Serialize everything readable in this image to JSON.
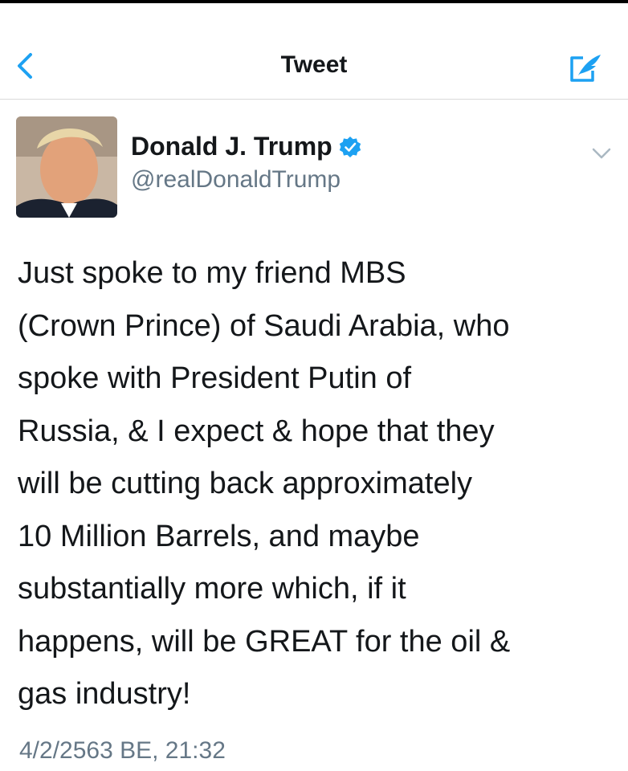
{
  "header": {
    "title": "Tweet",
    "back_icon": "chevron-left-icon",
    "compose_icon": "compose-tweet-icon"
  },
  "tweet": {
    "author": {
      "name": "Donald J. Trump",
      "handle": "@realDonaldTrump",
      "verified": true,
      "avatar_icon": "avatar"
    },
    "text_lines": [
      "Just spoke to my friend MBS",
      "(Crown Prince) of Saudi Arabia, who",
      "spoke with President Putin of",
      "Russia, & I expect & hope that they",
      "will be cutting back approximately",
      "10 Million Barrels, and maybe",
      "substantially more which, if it",
      "happens, will be GREAT for the oil &",
      "gas industry!"
    ],
    "timestamp": "4/2/2563 BE, 21:32"
  },
  "colors": {
    "accent": "#1da1f2",
    "text": "#14171a",
    "secondary_text": "#657786",
    "divider": "#d9d9d9"
  }
}
